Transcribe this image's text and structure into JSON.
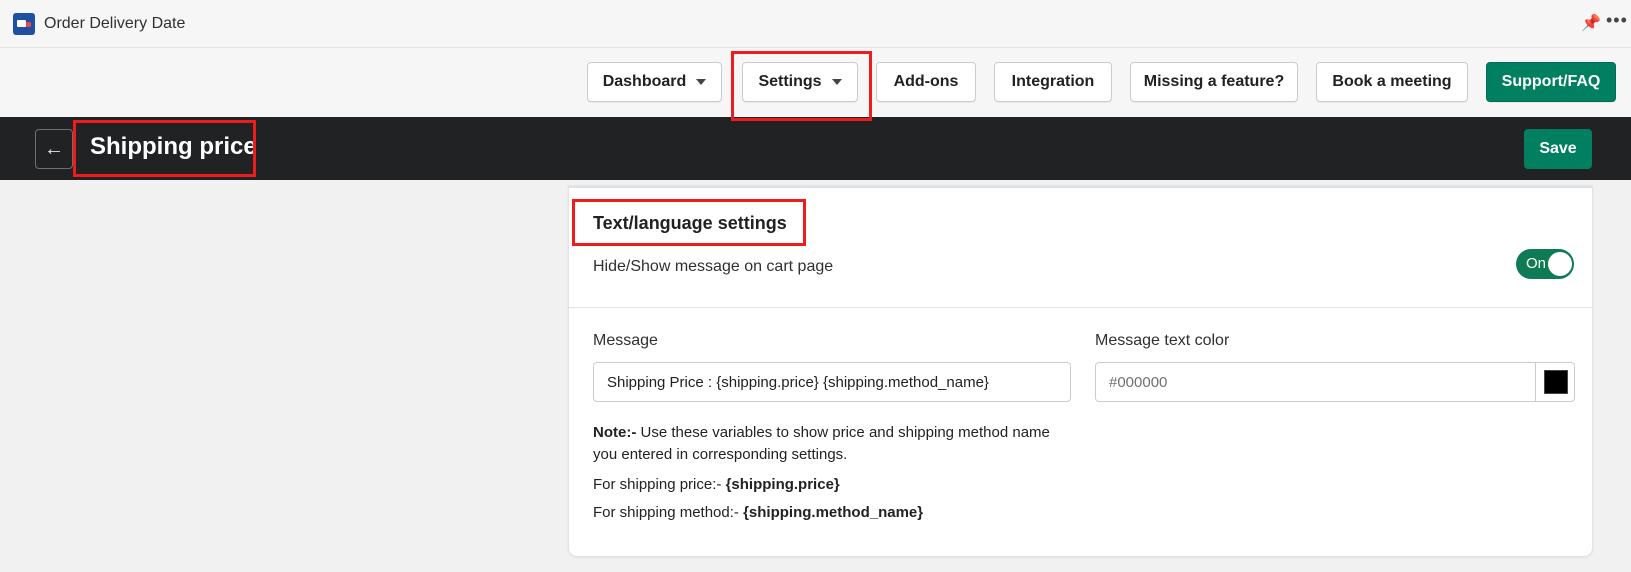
{
  "app": {
    "title": "Order Delivery Date"
  },
  "nav": {
    "dashboard": "Dashboard",
    "settings": "Settings",
    "addons": "Add-ons",
    "integration": "Integration",
    "missing_feature": "Missing a feature?",
    "book_meeting": "Book a meeting",
    "support": "Support/FAQ"
  },
  "header": {
    "title": "Shipping price",
    "save": "Save"
  },
  "section": {
    "title": "Text/language settings",
    "toggle_label": "Hide/Show message on cart page",
    "toggle_state": "On"
  },
  "message": {
    "label": "Message",
    "value": "Shipping Price : {shipping.price} {shipping.method_name}"
  },
  "color": {
    "label": "Message text color",
    "value": "#000000"
  },
  "note": {
    "prefix": "Note:-",
    "text": " Use these variables to show price and shipping method name you entered in corresponding settings."
  },
  "variables": [
    {
      "label": "For shipping price:- ",
      "token": "{shipping.price}"
    },
    {
      "label": "For shipping method:- ",
      "token": "{shipping.method_name}"
    }
  ],
  "colors": {
    "primary": "#008060",
    "highlight": "#ee1c1c",
    "header_bg": "#202223"
  }
}
